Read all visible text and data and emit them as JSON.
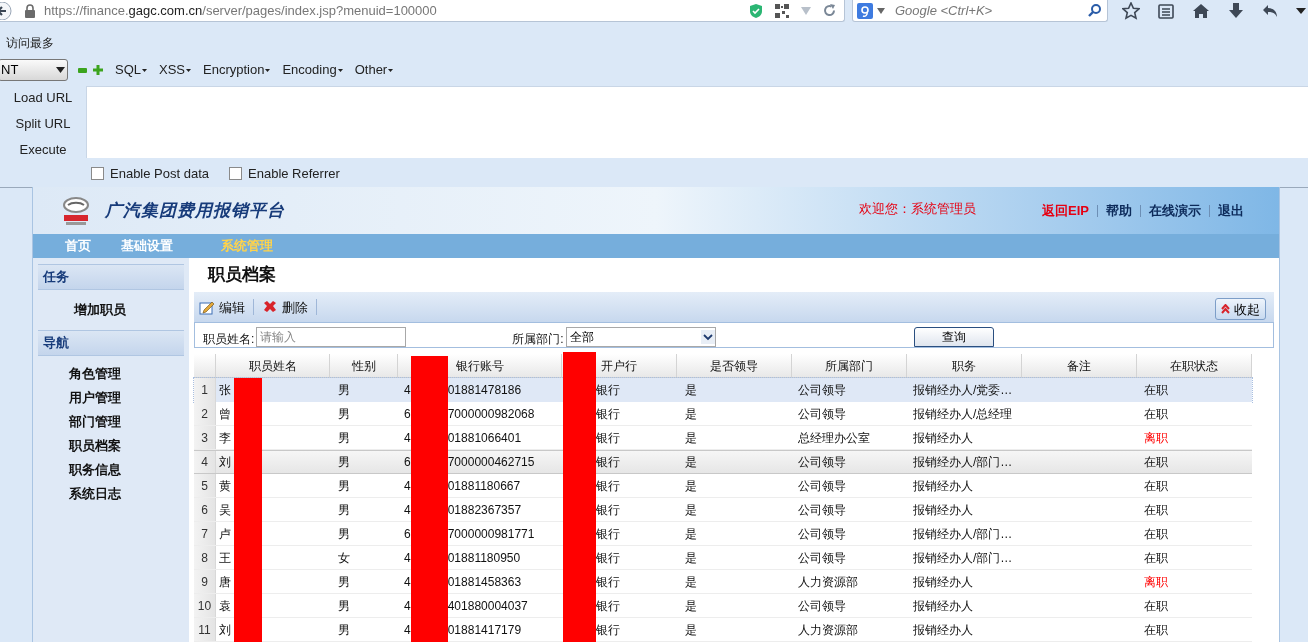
{
  "browser": {
    "url": "https://finance.gagc.com.cn/server/pages/index.jsp?menuid=100000",
    "search_placeholder": "Google <Ctrl+K>",
    "bookmark": "访问最多"
  },
  "hackbar": {
    "select_value": "NT",
    "menus": [
      "SQL",
      "XSS",
      "Encryption",
      "Encoding",
      "Other"
    ],
    "actions": [
      "Load URL",
      "Split URL",
      "Execute"
    ],
    "options": [
      {
        "label": "Enable Post data",
        "checked": false
      },
      {
        "label": "Enable Referrer",
        "checked": false
      }
    ]
  },
  "app": {
    "title": "广汽集团费用报销平台",
    "welcome": "欢迎您：系统管理员",
    "links": [
      {
        "label": "返回EIP",
        "kind": "highlight"
      },
      {
        "label": "帮助",
        "kind": "normal"
      },
      {
        "label": "在线演示",
        "kind": "normal"
      },
      {
        "label": "退出",
        "kind": "normal"
      }
    ],
    "nav": [
      {
        "label": "首页",
        "selected": false
      },
      {
        "label": "基础设置",
        "selected": false
      },
      {
        "label": "系统管理",
        "selected": true
      }
    ]
  },
  "sidebar": [
    {
      "heading": "任务",
      "items": [
        "增加职员"
      ]
    },
    {
      "heading": "导航",
      "items": [
        "角色管理",
        "用户管理",
        "部门管理",
        "职员档案",
        "职务信息",
        "系统日志"
      ]
    }
  ],
  "main": {
    "title": "职员档案",
    "toolbar": [
      "编辑",
      "删除"
    ],
    "collapse": "收起",
    "form": {
      "name_label": "职员姓名:",
      "name_placeholder": "请输入",
      "dept_label": "所属部门:",
      "dept_value": "全部",
      "query": "查询"
    },
    "columns": [
      "职员姓名",
      "性别",
      "银行账号",
      "开户行",
      "是否领导",
      "所属部门",
      "职务",
      "备注",
      "在职状态"
    ],
    "rows": [
      {
        "no": "1",
        "name": "张",
        "gender": "男",
        "account_prefix": "4",
        "account_suffix": "01881478186",
        "bank": "银行",
        "leader": "是",
        "dept": "公司领导",
        "position": "报销经办人/党委…",
        "status": "在职",
        "resigned": false,
        "selected": true,
        "hovered": false
      },
      {
        "no": "2",
        "name": "曾",
        "gender": "男",
        "account_prefix": "6",
        "account_suffix": "7000000982068",
        "bank": "银行",
        "leader": "是",
        "dept": "公司领导",
        "position": "报销经办人/总经理",
        "status": "在职",
        "resigned": false,
        "selected": false,
        "hovered": false
      },
      {
        "no": "3",
        "name": "李",
        "gender": "男",
        "account_prefix": "4",
        "account_suffix": "01881066401",
        "bank": "银行",
        "leader": "是",
        "dept": "总经理办公室",
        "position": "报销经办人",
        "status": "离职",
        "resigned": true,
        "selected": false,
        "hovered": false
      },
      {
        "no": "4",
        "name": "刘",
        "gender": "男",
        "account_prefix": "6",
        "account_suffix": "7000000462715",
        "bank": "银行",
        "leader": "是",
        "dept": "公司领导",
        "position": "报销经办人/部门…",
        "status": "在职",
        "resigned": false,
        "selected": false,
        "hovered": true
      },
      {
        "no": "5",
        "name": "黄",
        "gender": "男",
        "account_prefix": "4",
        "account_suffix": "01881180667",
        "bank": "银行",
        "leader": "是",
        "dept": "公司领导",
        "position": "报销经办人",
        "status": "在职",
        "resigned": false,
        "selected": false,
        "hovered": false
      },
      {
        "no": "6",
        "name": "吴",
        "gender": "男",
        "account_prefix": "4",
        "account_suffix": "01882367357",
        "bank": "银行",
        "leader": "是",
        "dept": "公司领导",
        "position": "报销经办人",
        "status": "在职",
        "resigned": false,
        "selected": false,
        "hovered": false
      },
      {
        "no": "7",
        "name": "卢",
        "gender": "男",
        "account_prefix": "6",
        "account_suffix": "7000000981771",
        "bank": "银行",
        "leader": "是",
        "dept": "公司领导",
        "position": "报销经办人/部门…",
        "status": "在职",
        "resigned": false,
        "selected": false,
        "hovered": false
      },
      {
        "no": "8",
        "name": "王",
        "gender": "女",
        "account_prefix": "4",
        "account_suffix": "01881180950",
        "bank": "银行",
        "leader": "是",
        "dept": "公司领导",
        "position": "报销经办人/部门…",
        "status": "在职",
        "resigned": false,
        "selected": false,
        "hovered": false
      },
      {
        "no": "9",
        "name": "唐",
        "gender": "男",
        "account_prefix": "4",
        "account_suffix": "01881458363",
        "bank": "银行",
        "leader": "是",
        "dept": "人力资源部",
        "position": "报销经办人",
        "status": "离职",
        "resigned": true,
        "selected": false,
        "hovered": false
      },
      {
        "no": "10",
        "name": "袁",
        "gender": "男",
        "account_prefix": "4",
        "account_suffix": "401880004037",
        "bank": "银行",
        "leader": "是",
        "dept": "公司领导",
        "position": "报销经办人",
        "status": "在职",
        "resigned": false,
        "selected": false,
        "hovered": false
      },
      {
        "no": "11",
        "name": "刘",
        "gender": "男",
        "account_prefix": "4",
        "account_suffix": "01881417179",
        "bank": "银行",
        "leader": "是",
        "dept": "人力资源部",
        "position": "报销经办人",
        "status": "在职",
        "resigned": false,
        "selected": false,
        "hovered": false
      }
    ]
  }
}
